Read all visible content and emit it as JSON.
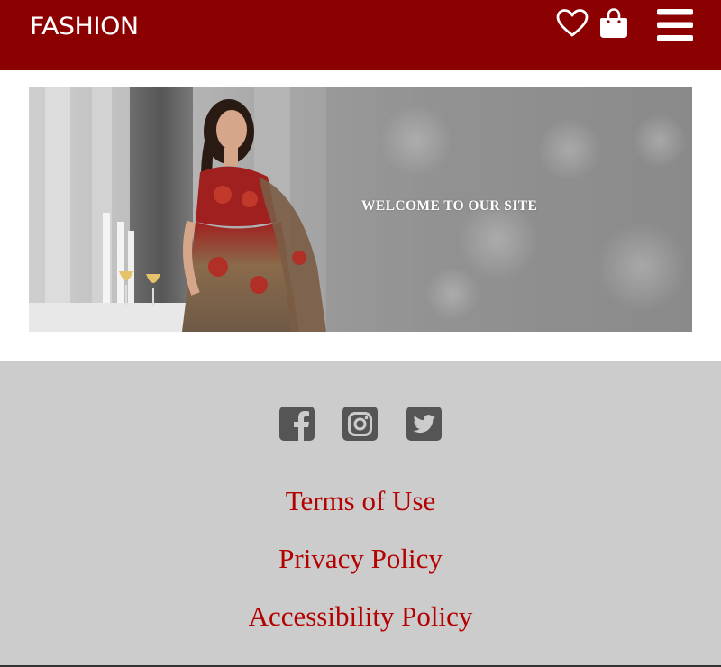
{
  "header": {
    "logo": "FASHION",
    "icons": [
      "heart-icon",
      "shopping-bag-icon",
      "hamburger-menu-icon"
    ],
    "background_color": "#8b0000"
  },
  "banner": {
    "text": "WELCOME TO OUR SITE"
  },
  "footer": {
    "background_color": "#cccccc",
    "social_icons": [
      "facebook-icon",
      "instagram-icon",
      "twitter-icon"
    ],
    "links": [
      {
        "label": "Terms of Use"
      },
      {
        "label": "Privacy Policy"
      },
      {
        "label": "Accessibility Policy"
      }
    ],
    "link_color": "#b30000"
  }
}
